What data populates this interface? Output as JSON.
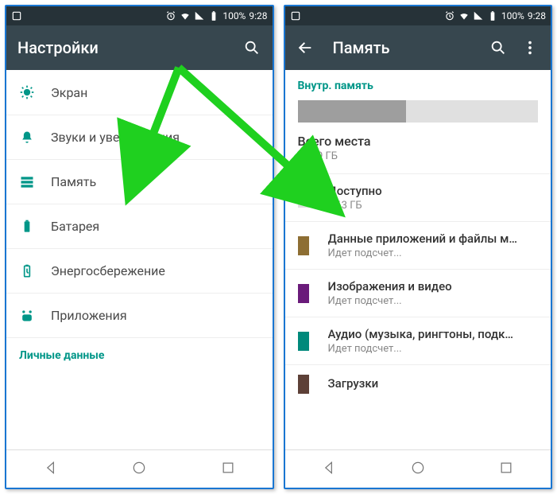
{
  "status": {
    "battery": "100%",
    "time": "9:28"
  },
  "left": {
    "title": "Настройки",
    "items": [
      {
        "key": "display",
        "label": "Экран"
      },
      {
        "key": "sound",
        "label": "Звуки и уведомления"
      },
      {
        "key": "storage",
        "label": "Память"
      },
      {
        "key": "battery",
        "label": "Батарея"
      },
      {
        "key": "power",
        "label": "Энергосбережение"
      },
      {
        "key": "apps",
        "label": "Приложения"
      }
    ],
    "personal_header": "Личные данные"
  },
  "right": {
    "title": "Память",
    "internal_header": "Внутр. память",
    "bar": {
      "segments": [
        {
          "color": "#9e9e9e",
          "pct": 45
        },
        {
          "color": "#e0e0e0",
          "pct": 55
        }
      ]
    },
    "total": {
      "label": "Всего места",
      "value": "11,99 ГБ"
    },
    "rows": [
      {
        "color": "#e0e0e0",
        "title": "Доступно",
        "sub": "6,63 ГБ"
      },
      {
        "color": "#8d6e33",
        "title": "Данные приложений и файлы мул.",
        "sub": "Идет подсчет..."
      },
      {
        "color": "#6a1b7a",
        "title": "Изображения и видео",
        "sub": "Идет подсчет..."
      },
      {
        "color": "#00897b",
        "title": "Аудио (музыка, рингтоны, подкаст.",
        "sub": "Идет подсчет..."
      },
      {
        "color": "#5d4037",
        "title": "Загрузки",
        "sub": ""
      }
    ]
  },
  "colors": {
    "accent": "#009688",
    "appbar": "#37474F",
    "arrow": "#1fd01f"
  }
}
